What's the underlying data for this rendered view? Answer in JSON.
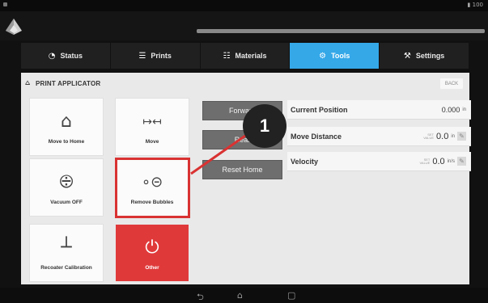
{
  "statusbar": {
    "battery_text": "▮ 100"
  },
  "header": {
    "logo_icon": "pyramid-logo-icon",
    "progress": 1.0
  },
  "tabs": [
    {
      "label": "Status",
      "icon": "clock-icon",
      "glyph": "◔",
      "active": false
    },
    {
      "label": "Prints",
      "icon": "list-icon",
      "glyph": "☰",
      "active": false
    },
    {
      "label": "Materials",
      "icon": "materials-icon",
      "glyph": "☷",
      "active": false
    },
    {
      "label": "Tools",
      "icon": "gear-icon",
      "glyph": "⚙",
      "active": true
    },
    {
      "label": "Settings",
      "icon": "wrench-icon",
      "glyph": "⚒",
      "active": false
    }
  ],
  "panel": {
    "title": "PRINT APPLICATOR",
    "title_icon": "applicator-icon",
    "back_label": "BACK"
  },
  "tiles": {
    "move_to_home": {
      "label": "Move to Home",
      "icon": "home-icon",
      "glyph": "⌂"
    },
    "move": {
      "label": "Move",
      "icon": "move-arrows-icon",
      "glyph": "↦↤"
    },
    "vacuum": {
      "label": "Vacuum OFF",
      "icon": "vacuum-icon",
      "glyph": "⨸"
    },
    "remove_bubbles": {
      "label": "Remove Bubbles",
      "icon": "bubbles-icon",
      "glyph": "∘⊝"
    },
    "recoater": {
      "label": "Recoater Calibration",
      "icon": "recoater-icon",
      "glyph": "┴"
    },
    "other": {
      "label": "Other",
      "icon": "power-icon",
      "glyph": "⏻"
    }
  },
  "actions": {
    "forward": "Forward",
    "rear": "Rear",
    "reset_home": "Reset Home"
  },
  "info": {
    "current_position": {
      "label": "Current Position",
      "value": "0.000",
      "unit": "in"
    },
    "move_distance": {
      "label": "Move Distance",
      "tag": "SET VALUE",
      "value": "0.0",
      "unit": "in"
    },
    "velocity": {
      "label": "Velocity",
      "tag": "SET VALUE",
      "value": "0.0",
      "unit": "in/s"
    }
  },
  "annotation": {
    "number": "1",
    "color": "#d93232"
  },
  "colors": {
    "accent": "#35a8e8",
    "danger": "#e0393a"
  },
  "navbar": {
    "back_icon": "back-icon",
    "home_icon": "home-nav-icon",
    "recents_icon": "recents-icon"
  }
}
